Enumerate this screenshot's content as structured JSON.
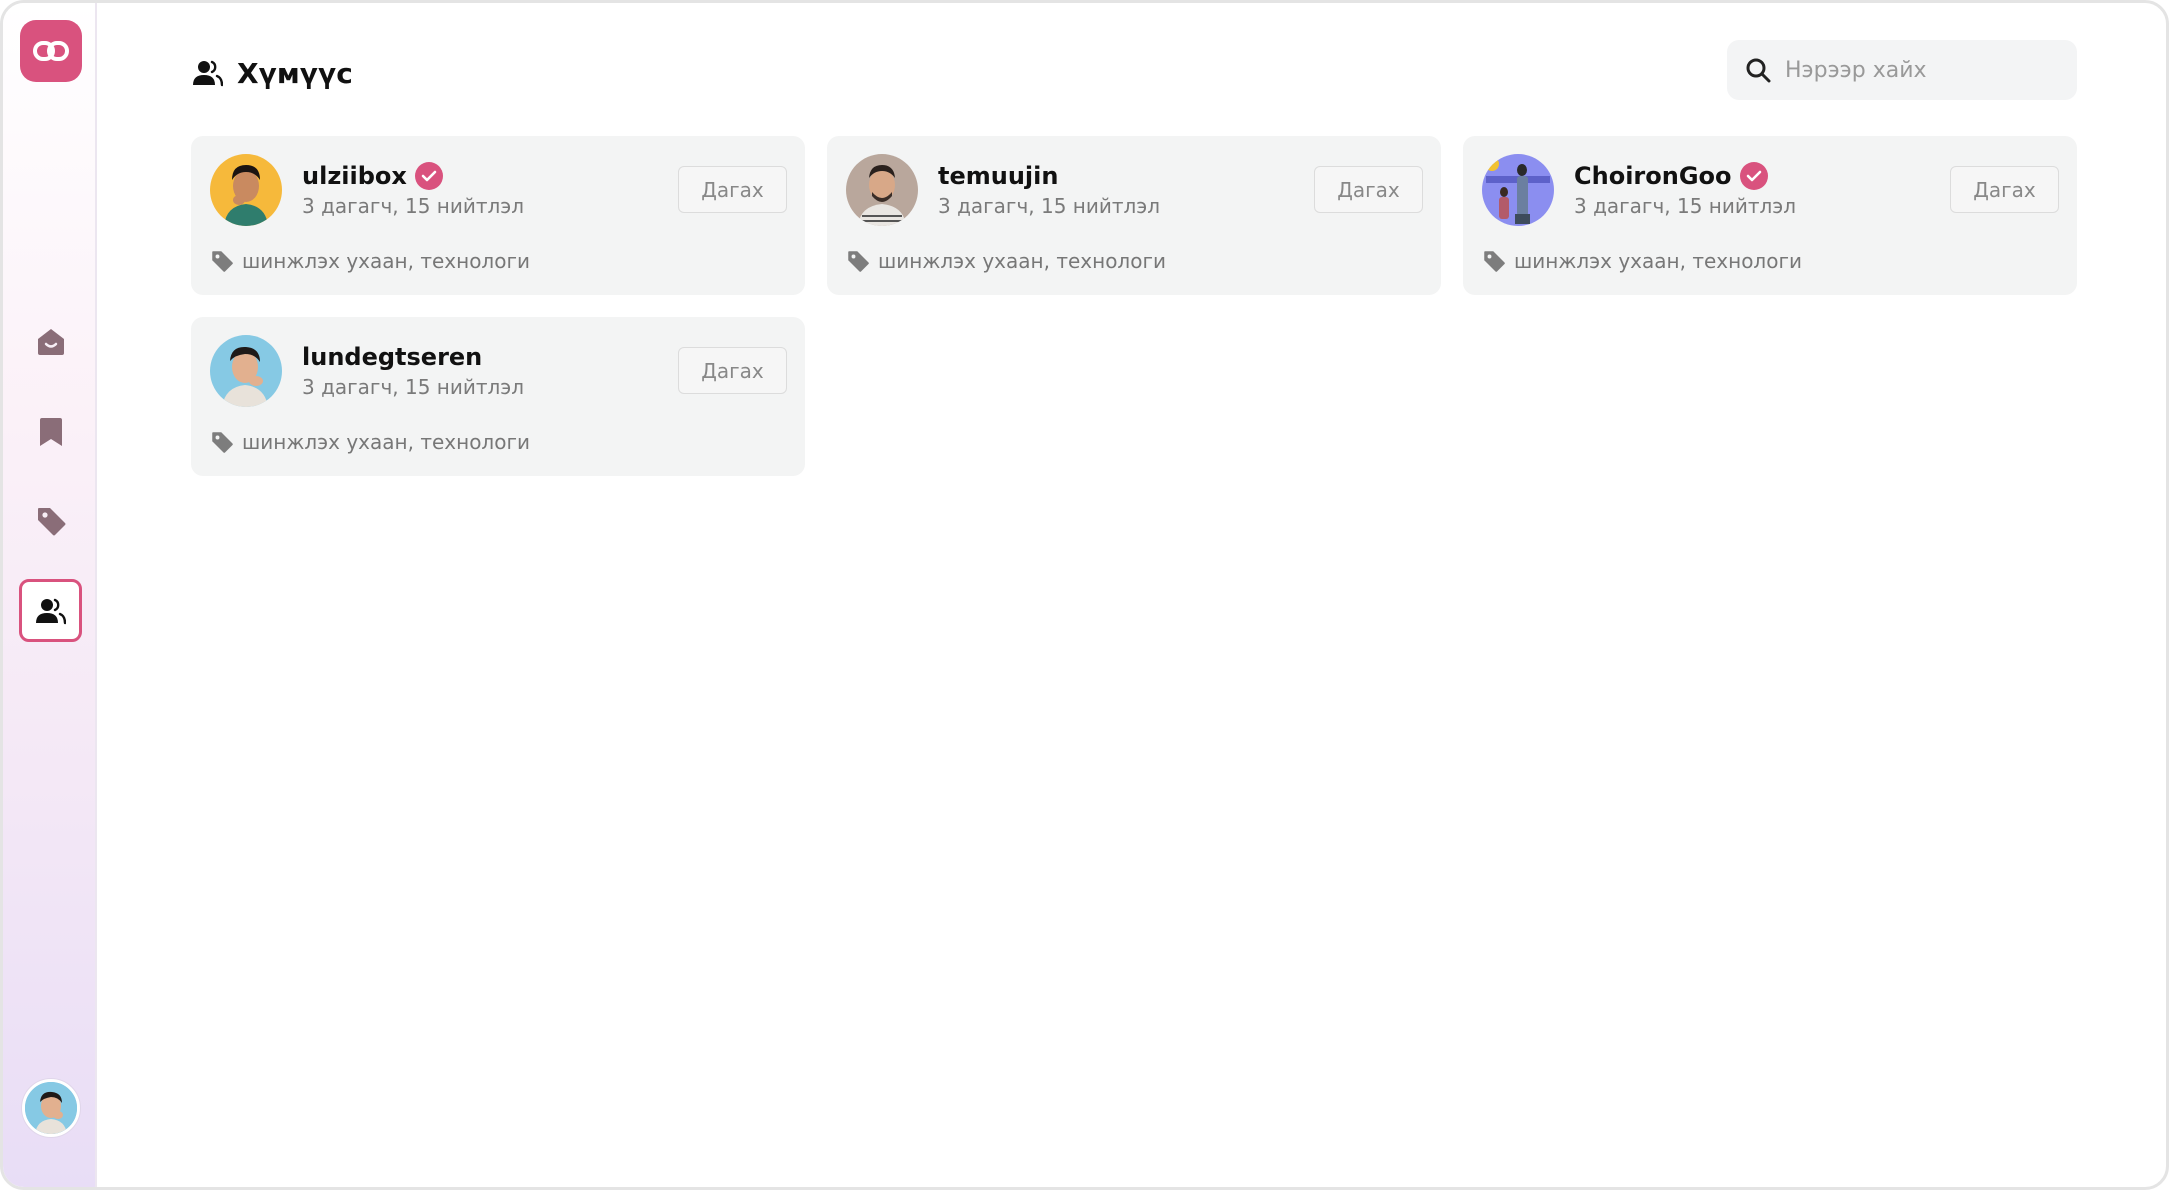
{
  "page": {
    "title": "Хүмүүс"
  },
  "search": {
    "placeholder": "Нэрээр хайх"
  },
  "sidebar": {
    "items": [
      {
        "name": "home",
        "active": false
      },
      {
        "name": "bookmark",
        "active": false
      },
      {
        "name": "tag",
        "active": false
      },
      {
        "name": "people",
        "active": true
      }
    ]
  },
  "colors": {
    "accent": "#d9527e",
    "card_bg": "#f3f4f4",
    "icon_muted": "#8a6d78"
  },
  "users": [
    {
      "name": "ulziibox",
      "verified": true,
      "stats": "3 дагагч, 15 нийтлэл",
      "follow_label": "Дагах",
      "tags": "шинжлэх ухаан, технологи"
    },
    {
      "name": "temuujin",
      "verified": false,
      "stats": "3 дагагч, 15 нийтлэл",
      "follow_label": "Дагах",
      "tags": "шинжлэх ухаан, технологи"
    },
    {
      "name": "ChoironGoo",
      "verified": true,
      "stats": "3 дагагч, 15 нийтлэл",
      "follow_label": "Дагах",
      "tags": "шинжлэх ухаан, технологи"
    },
    {
      "name": "lundegtseren",
      "verified": false,
      "stats": "3 дагагч, 15 нийтлэл",
      "follow_label": "Дагах",
      "tags": "шинжлэх ухаан, технологи"
    }
  ]
}
